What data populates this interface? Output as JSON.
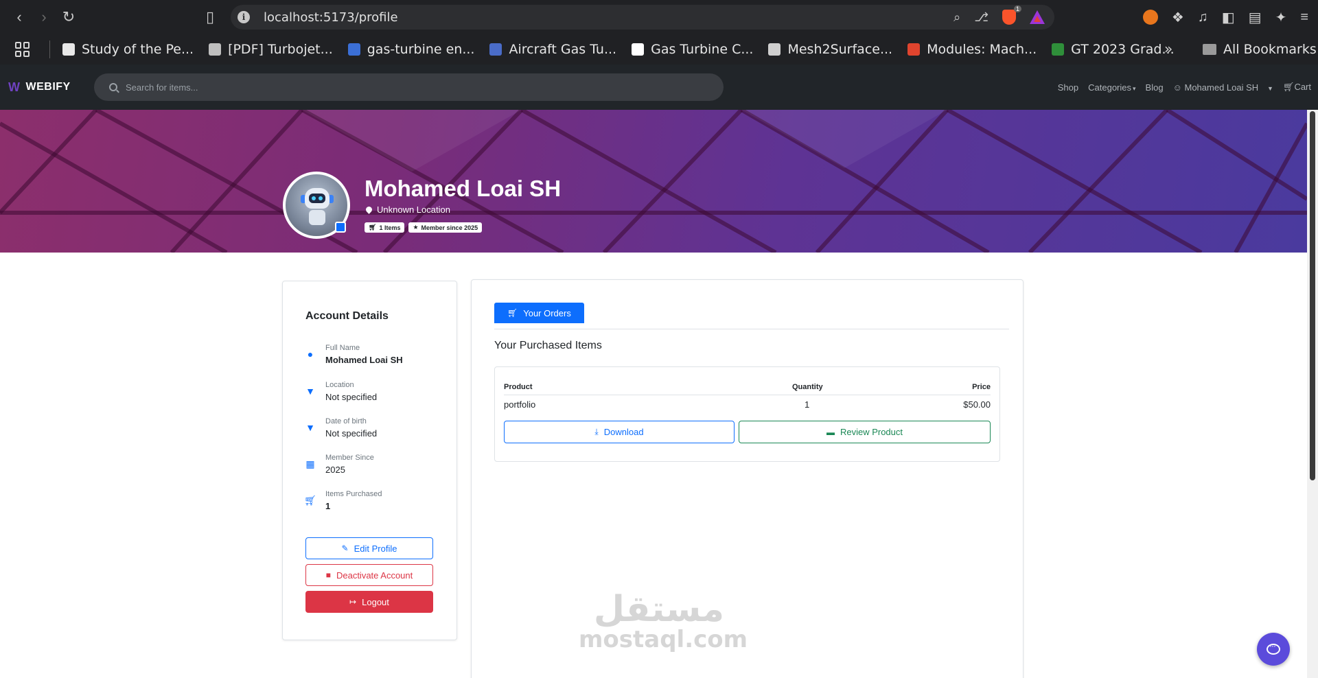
{
  "browser": {
    "url": "localhost:5173/profile",
    "brave_badge": "1",
    "bookmarks": [
      {
        "label": "Study of the Pe...",
        "color": "#e8e8e8"
      },
      {
        "label": "[PDF] Turbojet...",
        "color": "#bfbfbf"
      },
      {
        "label": "gas-turbine en...",
        "color": "#3b6fd6"
      },
      {
        "label": "Aircraft Gas Tu...",
        "color": "#4a6cc8"
      },
      {
        "label": "Gas Turbine C...",
        "color": "#ffffff"
      },
      {
        "label": "Mesh2Surface...",
        "color": "#cfcfcf"
      },
      {
        "label": "Modules: Mach...",
        "color": "#e0442e"
      },
      {
        "label": "GT 2023 Grad...",
        "color": "#2f8f3a"
      }
    ],
    "all_bookmarks": "All Bookmarks"
  },
  "header": {
    "logo": "WEBIFY",
    "search_placeholder": "Search for items...",
    "links": {
      "shop": "Shop",
      "categories": "Categories",
      "blog": "Blog",
      "user": "Mohamed Loai SH",
      "cart": "Cart"
    }
  },
  "profile": {
    "name": "Mohamed Loai SH",
    "location": "Unknown Location",
    "badge_items": "1 Items",
    "badge_member": "Member since 2025"
  },
  "account": {
    "title": "Account Details",
    "details": [
      {
        "label": "Full Name",
        "value": "Mohamed Loai SH",
        "icon": "user-icon"
      },
      {
        "label": "Location",
        "value": "Not specified",
        "icon": "map-pin-icon"
      },
      {
        "label": "Date of birth",
        "value": "Not specified",
        "icon": "map-pin-icon"
      },
      {
        "label": "Member Since",
        "value": "2025",
        "icon": "calendar-icon"
      },
      {
        "label": "Items Purchased",
        "value": "1",
        "icon": "cart-icon"
      }
    ],
    "edit_label": "Edit Profile",
    "deactivate_label": "Deactivate Account",
    "logout_label": "Logout"
  },
  "orders": {
    "tab_label": "Your Orders",
    "section_title": "Your Purchased Items",
    "columns": [
      "Product",
      "Quantity",
      "Price"
    ],
    "rows": [
      {
        "product": "portfolio",
        "quantity": "1",
        "price": "$50.00"
      }
    ],
    "download_label": "Download",
    "review_label": "Review Product"
  },
  "watermark": {
    "arabic": "مستقل",
    "latin": "mostaql.com"
  },
  "colors": {
    "primary": "#0d6efd",
    "danger": "#dc3545",
    "success": "#198754",
    "navbar": "#212529",
    "chat_fab": "#5b4bdb"
  }
}
